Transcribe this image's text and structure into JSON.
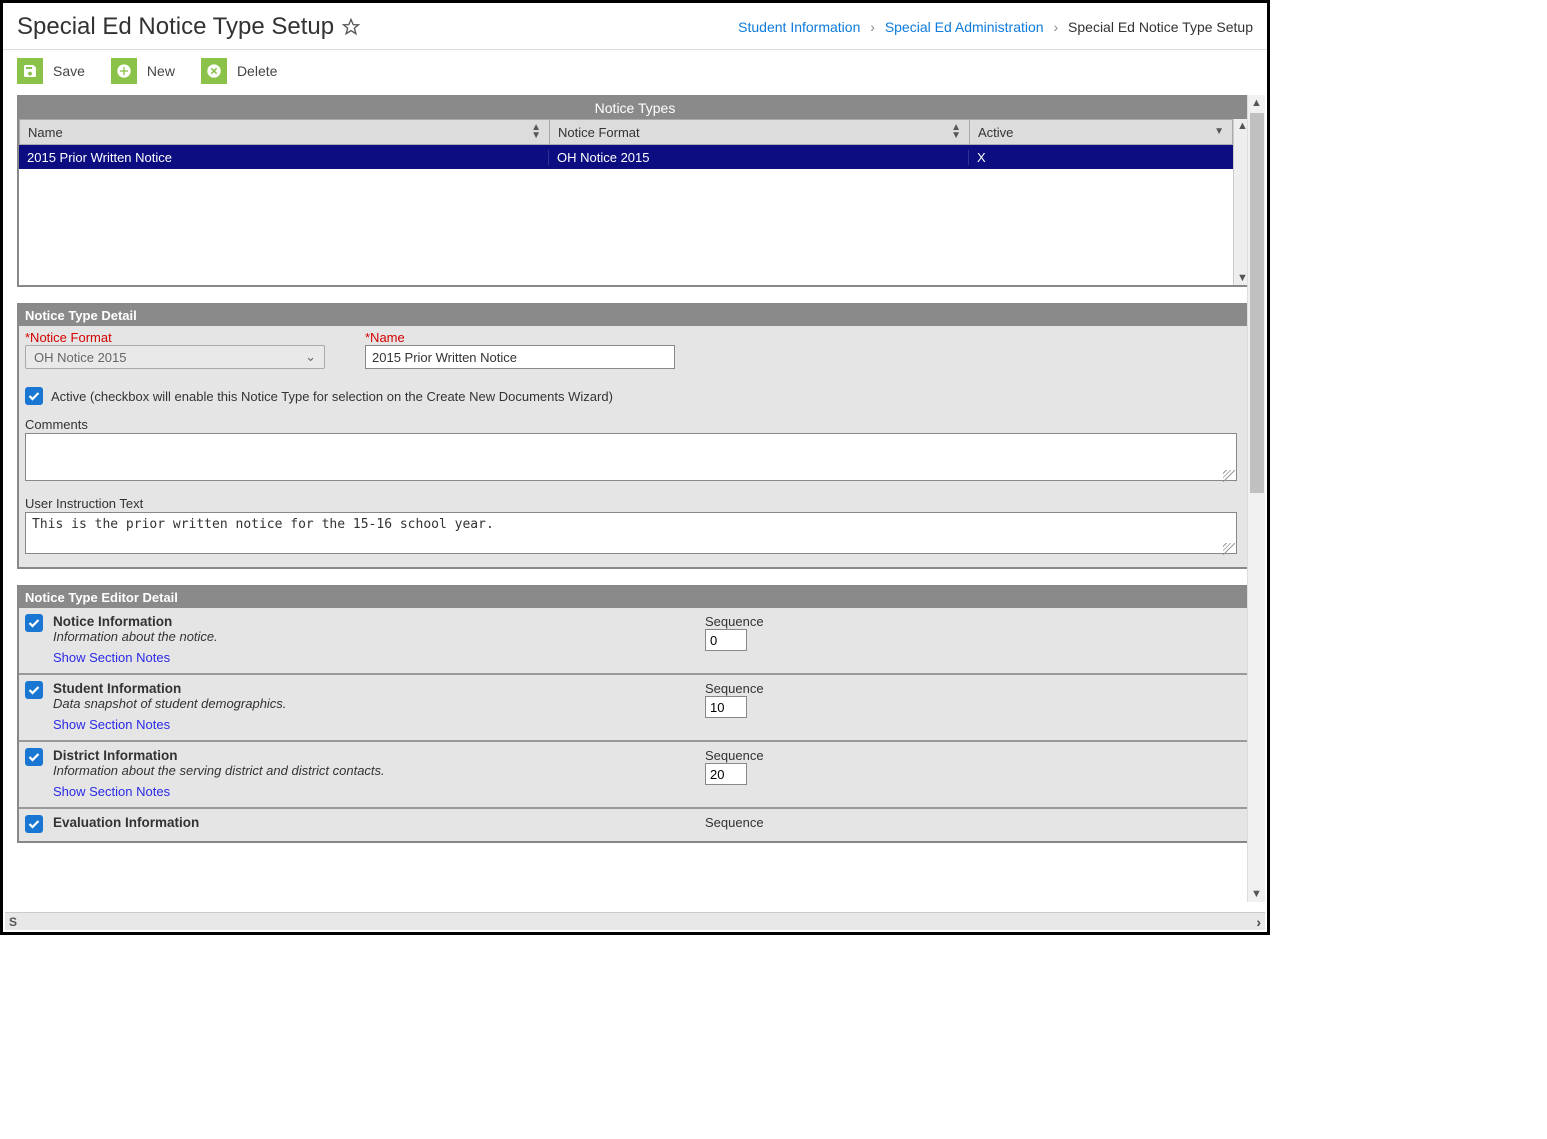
{
  "header": {
    "title": "Special Ed Notice Type Setup",
    "breadcrumb": {
      "link1": "Student Information",
      "link2": "Special Ed Administration",
      "current": "Special Ed Notice Type Setup"
    }
  },
  "toolbar": {
    "save": "Save",
    "new": "New",
    "delete": "Delete"
  },
  "noticeTypes": {
    "title": "Notice Types",
    "columns": {
      "name": "Name",
      "format": "Notice Format",
      "active": "Active"
    },
    "rows": [
      {
        "name": "2015 Prior Written Notice",
        "format": "OH Notice 2015",
        "active": "X"
      }
    ]
  },
  "detail": {
    "title": "Notice Type Detail",
    "noticeFormatLabel": "*Notice Format",
    "noticeFormatValue": "OH Notice 2015",
    "nameLabel": "*Name",
    "nameValue": "2015 Prior Written Notice",
    "activeLabel": "Active (checkbox will enable this Notice Type for selection on the Create New Documents Wizard)",
    "commentsLabel": "Comments",
    "commentsValue": "",
    "userInstrLabel": "User Instruction Text",
    "userInstrValue": "This is the prior written notice for the 15-16 school year."
  },
  "editor": {
    "title": "Notice Type Editor Detail",
    "sequenceLabel": "Sequence",
    "showNotes": "Show Section Notes",
    "sections": [
      {
        "title": "Notice Information",
        "desc": "Information about the notice.",
        "seq": "0",
        "showLink": true
      },
      {
        "title": "Student Information",
        "desc": "Data snapshot of student demographics.",
        "seq": "10",
        "showLink": true
      },
      {
        "title": "District Information",
        "desc": "Information about the serving district and district contacts.",
        "seq": "20",
        "showLink": true
      },
      {
        "title": "Evaluation Information",
        "desc": "",
        "seq": "",
        "showLink": false
      }
    ]
  }
}
